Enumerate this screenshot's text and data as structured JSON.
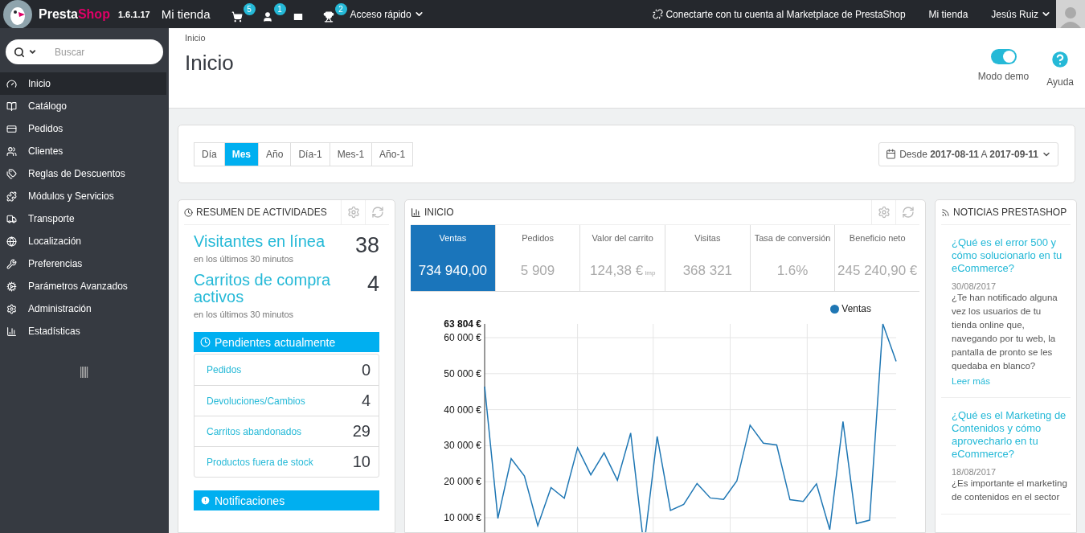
{
  "topbar": {
    "brand_name": "Presta",
    "brand_accent": "Shop",
    "version": "1.6.1.17",
    "shop": "Mi tienda",
    "notifications": [
      {
        "kind": "orders",
        "count": "5"
      },
      {
        "kind": "customers",
        "count": "1"
      },
      {
        "kind": "messages"
      },
      {
        "kind": "trophy",
        "count": "2"
      }
    ],
    "quick_access": "Acceso rápido",
    "marketplace": "Conectarte con tu cuenta al Marketplace de PrestaShop",
    "shop_link": "Mi tienda",
    "user": "Jesús Ruiz"
  },
  "sidebar": {
    "search": {
      "placeholder": "Buscar"
    },
    "items": [
      {
        "kind": "dashboard",
        "label": "Inicio",
        "selected": true
      },
      {
        "kind": "catalog",
        "label": "Catálogo",
        "selected": false
      },
      {
        "kind": "orders",
        "label": "Pedidos",
        "selected": false
      },
      {
        "kind": "customers",
        "label": "Clientes",
        "selected": false
      },
      {
        "kind": "discounts",
        "label": "Reglas de Descuentos",
        "selected": false
      },
      {
        "kind": "modules",
        "label": "Módulos y Servicios",
        "selected": false
      },
      {
        "kind": "shipping",
        "label": "Transporte",
        "selected": false
      },
      {
        "kind": "localization",
        "label": "Localización",
        "selected": false
      },
      {
        "kind": "preferences",
        "label": "Preferencias",
        "selected": false
      },
      {
        "kind": "advanced",
        "label": "Parámetros Avanzados",
        "selected": false
      },
      {
        "kind": "administration",
        "label": "Administración",
        "selected": false
      },
      {
        "kind": "stats",
        "label": "Estadísticas",
        "selected": false
      }
    ]
  },
  "header": {
    "breadcrumb": "Inicio",
    "title": "Inicio",
    "demo_mode": {
      "label": "Modo demo",
      "on": true
    },
    "help": {
      "label": "Ayuda"
    }
  },
  "date_panel": {
    "ranges": [
      {
        "label": "Día",
        "selected": false
      },
      {
        "label": "Mes",
        "selected": true
      },
      {
        "label": "Año",
        "selected": false
      },
      {
        "label": "Día-1",
        "selected": false
      },
      {
        "label": "Mes-1",
        "selected": false
      },
      {
        "label": "Año-1",
        "selected": false
      }
    ],
    "range": "Desde **2017-08-11** A **2017-09-11**"
  },
  "activity": {
    "title": "RESUMEN DE ACTIVIDADES",
    "stats": [
      {
        "label": "Visitantes en línea",
        "value": "38",
        "note": "en los últimos 30 minutos"
      },
      {
        "label": "Carritos de compra activos",
        "value": "4",
        "note": "en los últimos 30 minutos"
      }
    ],
    "pending": {
      "title": "Pendientes actualmente",
      "rows": [
        {
          "label": "Pedidos",
          "value": "0"
        },
        {
          "label": "Devoluciones/Cambios",
          "value": "4"
        },
        {
          "label": "Carritos abandonados",
          "value": "29"
        },
        {
          "label": "Productos fuera de stock",
          "value": "10"
        }
      ]
    },
    "notifications": {
      "title": "Notificaciones"
    }
  },
  "dashboard": {
    "title": "INICIO",
    "kpis": [
      {
        "label": "Ventas",
        "value": "734 940,00",
        "selected": true
      },
      {
        "label": "Pedidos",
        "value": "5 909",
        "selected": false
      },
      {
        "label": "Valor del carrito",
        "value": "124,38 €",
        "suffix": "imp",
        "selected": false
      },
      {
        "label": "Visitas",
        "value": "368 321",
        "selected": false
      },
      {
        "label": "Tasa de conversión",
        "value": "1.6%",
        "selected": false
      },
      {
        "label": "Beneficio neto",
        "value": "245 240,90 €",
        "selected": false
      }
    ],
    "chart_data": {
      "type": "line",
      "grid": true,
      "ylim": [
        5000,
        63804
      ],
      "yticks": [
        {
          "value": 10000,
          "label": "10 000 €"
        },
        {
          "value": 20000,
          "label": "20 000 €"
        },
        {
          "value": 30000,
          "label": "30 000 €"
        },
        {
          "value": 40000,
          "label": "40 000 €"
        },
        {
          "value": 50000,
          "label": "50 000 €"
        },
        {
          "value": 60000,
          "label": "60 000 €"
        },
        {
          "value": 63804,
          "label": "63 804 €"
        }
      ],
      "series": [
        {
          "name": "Ventas",
          "color": "#1f77b4",
          "values": [
            46400,
            9800,
            26400,
            21600,
            7800,
            18400,
            15400,
            29400,
            21900,
            28000,
            20400,
            33500,
            null,
            32600,
            12000,
            13700,
            19500,
            15500,
            15100,
            20200,
            35700,
            30700,
            30200,
            15000,
            14500,
            19400,
            6700,
            36700,
            8400,
            9300,
            63804,
            53400
          ]
        }
      ]
    }
  },
  "news": {
    "title": "NOTICIAS PRESTASHOP",
    "items": [
      {
        "title": "¿Qué es el error 500 y cómo solucionarlo en tu eCommerce?",
        "date": "30/08/2017",
        "body": "¿Te han notificado alguna vez los usuarios de tu tienda online que, navegando por tu web, la pantalla de pronto se les quedaba en blanco?",
        "link": "Leer más"
      },
      {
        "title": "¿Qué es el Marketing de Contenidos y cómo aprovecharlo en tu eCommerce?",
        "date": "18/08/2017",
        "body": "¿Es importante el marketing de contenidos en el sector"
      }
    ]
  }
}
